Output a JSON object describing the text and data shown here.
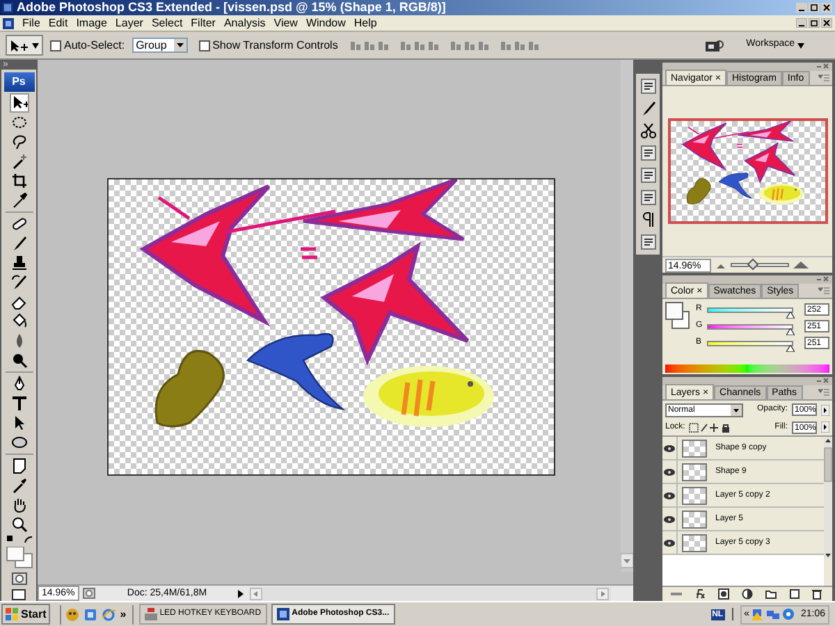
{
  "window": {
    "title": "Adobe Photoshop CS3 Extended - [vissen.psd @ 15% (Shape 1, RGB/8)]"
  },
  "menu": [
    "File",
    "Edit",
    "Image",
    "Layer",
    "Select",
    "Filter",
    "Analysis",
    "View",
    "Window",
    "Help"
  ],
  "options_bar": {
    "auto_select": {
      "label": "Auto-Select:",
      "checked": false
    },
    "auto_select_target": "Group",
    "show_transform": {
      "label": "Show Transform Controls",
      "checked": false
    },
    "workspace": "Workspace"
  },
  "toolbox": {
    "header": "»",
    "logo": "Ps"
  },
  "navigator": {
    "tabs": [
      {
        "label": "Navigator ×",
        "selected": true
      },
      {
        "label": "Histogram",
        "selected": false
      },
      {
        "label": "Info",
        "selected": false
      }
    ],
    "zoom": "14.96%",
    "level": 0.38
  },
  "color": {
    "tabs": [
      {
        "label": "Color ×",
        "selected": true
      },
      {
        "label": "Swatches",
        "selected": false
      },
      {
        "label": "Styles",
        "selected": false
      }
    ],
    "channels": [
      {
        "label": "R",
        "level": 0.99,
        "value": "252"
      },
      {
        "label": "G",
        "level": 0.98,
        "value": "251"
      },
      {
        "label": "B",
        "level": 0.98,
        "value": "251"
      }
    ]
  },
  "layers": {
    "tabs": [
      {
        "label": "Layers ×",
        "selected": true
      },
      {
        "label": "Channels",
        "selected": false
      },
      {
        "label": "Paths",
        "selected": false
      }
    ],
    "blend_mode": "Normal",
    "opacity_label": "Opacity:",
    "opacity": "100%",
    "lock_label": "Lock:",
    "fill_label": "Fill:",
    "fill": "100%",
    "items": [
      {
        "name": "Shape 9 copy",
        "visible": true
      },
      {
        "name": "Shape 9",
        "visible": true
      },
      {
        "name": "Layer 5 copy 2",
        "visible": true
      },
      {
        "name": "Layer 5",
        "visible": true
      },
      {
        "name": "Layer 5 copy 3",
        "visible": true
      }
    ]
  },
  "status_bar": {
    "zoom": "14.96%",
    "doc": "Doc: 25,4M/61,8M"
  },
  "taskbar": {
    "start": "Start",
    "more": "»",
    "tasks": [
      {
        "label": "LED HOTKEY KEYBOARD",
        "selected": false
      },
      {
        "label": "Adobe Photoshop CS3...",
        "selected": true
      }
    ],
    "language": "NL",
    "tray_expand": "«",
    "clock": "21:06"
  }
}
